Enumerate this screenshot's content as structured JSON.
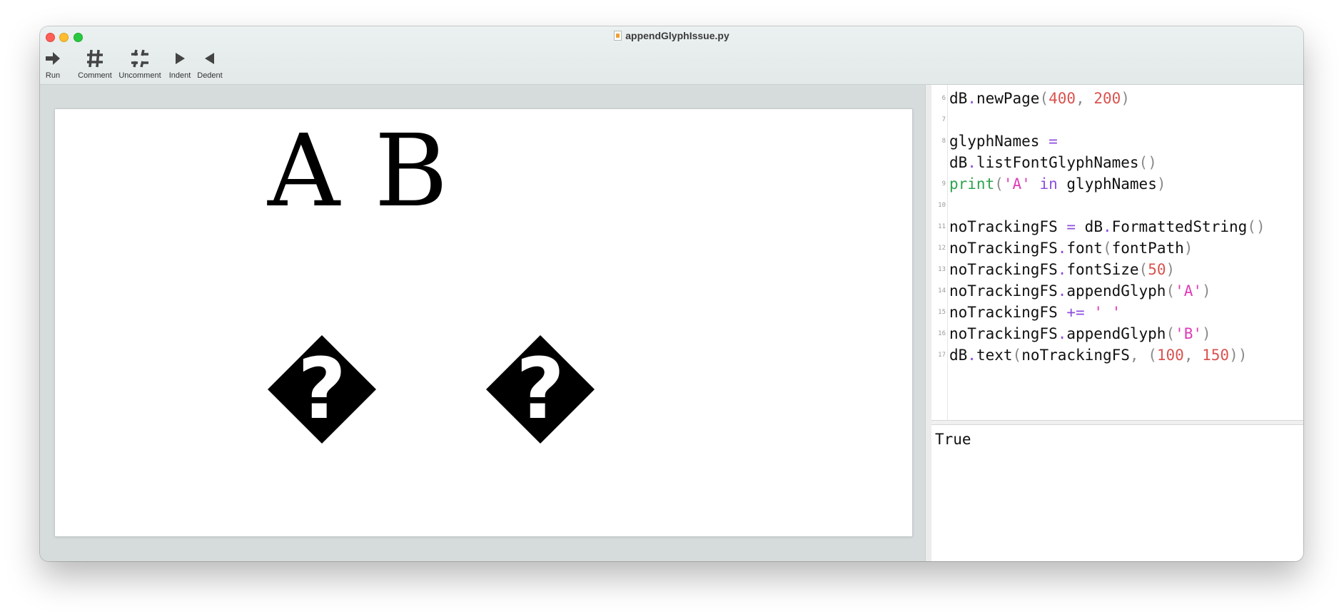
{
  "window": {
    "title": "appendGlyphIssue.py"
  },
  "toolbar": {
    "items": [
      {
        "label": "Run",
        "icon": "run-arrow-icon"
      },
      {
        "label": "Comment",
        "icon": "hash-icon"
      },
      {
        "label": "Uncomment",
        "icon": "uncomment-hash-icon"
      },
      {
        "label": "Indent",
        "icon": "indent-triangle-icon"
      },
      {
        "label": "Dedent",
        "icon": "dedent-triangle-icon"
      }
    ]
  },
  "canvas": {
    "rendered_text": "A B",
    "missing_glyph": "?"
  },
  "editor": {
    "gutter": [
      "6",
      "7",
      "8",
      "9",
      "10",
      "11",
      "12",
      "13",
      "14",
      "15",
      "16",
      "17"
    ],
    "lines": [
      "dB.newPage(400, 200)",
      "",
      "glyphNames =",
      "dB.listFontGlyphNames()",
      "print('A' in glyphNames)",
      "",
      "noTrackingFS = dB.FormattedString()",
      "noTrackingFS.font(fontPath)",
      "noTrackingFS.fontSize(50)",
      "noTrackingFS.appendGlyph('A')",
      "noTrackingFS += ' '",
      "noTrackingFS.appendGlyph('B')",
      "dB.text(noTrackingFS, (100, 150))"
    ]
  },
  "output": {
    "text": "True"
  },
  "colors": {
    "close": "#ff5f57",
    "minimize": "#febc2e",
    "maximize": "#28c840",
    "syntax_operator": "#8d4de0",
    "syntax_number": "#d9534f",
    "syntax_string": "#e03bb8",
    "syntax_builtin": "#2ea44f"
  }
}
